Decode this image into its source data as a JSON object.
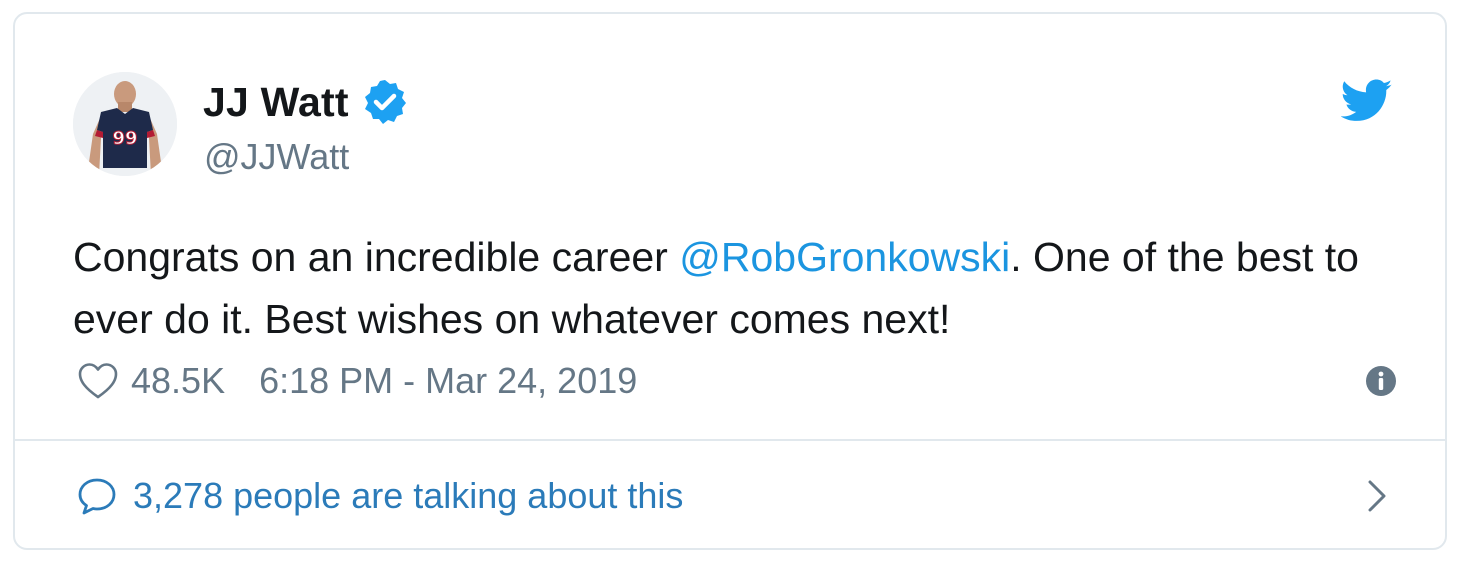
{
  "author": {
    "name": "JJ Watt",
    "handle": "@JJWatt",
    "avatar_icon": "player-avatar-icon",
    "verified": true,
    "jersey_number": "99"
  },
  "tweet": {
    "text_before": "Congrats on an incredible career ",
    "mention": "@RobGronkowski",
    "text_after": ". One of the best to ever do it. Best wishes on whatever comes next!"
  },
  "meta": {
    "likes": "48.5K",
    "timestamp": "6:18 PM - Mar 24, 2019"
  },
  "footer": {
    "talking_label": "3,278 people are talking about this"
  },
  "colors": {
    "accent": "#1da1f2",
    "mention": "#1b95e0",
    "secondary_text": "#657786",
    "link": "#2b7bb9",
    "border": "#e1e8ed"
  }
}
